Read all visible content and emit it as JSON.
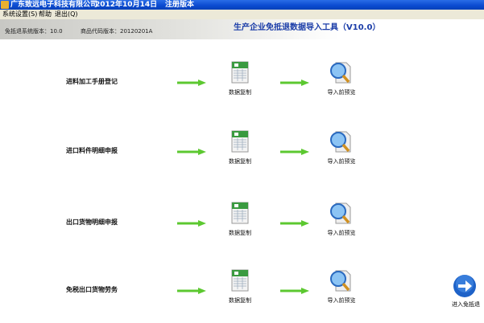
{
  "titlebar": {
    "company": "广东致远电子科技有限公司",
    "date": "2012年10月14日",
    "edition": "注册版本"
  },
  "menu": [
    "系统设置(S)",
    "帮助",
    "退出(Q)"
  ],
  "banner": {
    "system_version": "免抵退系统版本：10.0",
    "product_code_version": "商品代码版本：20120201A"
  },
  "app_title": "生产企业免抵退数据导入工具（V10.0）",
  "rows": [
    {
      "label": "进料加工手册登记",
      "copy": "数据复制",
      "preview": "导入前预览"
    },
    {
      "label": "进口料件明细申报",
      "copy": "数据复制",
      "preview": "导入前预览"
    },
    {
      "label": "出口货物明细申报",
      "copy": "数据复制",
      "preview": "导入前预览"
    },
    {
      "label": "免税出口货物劳务",
      "copy": "数据复制",
      "preview": "导入前预览"
    }
  ],
  "enter_button": "进入免抵退"
}
